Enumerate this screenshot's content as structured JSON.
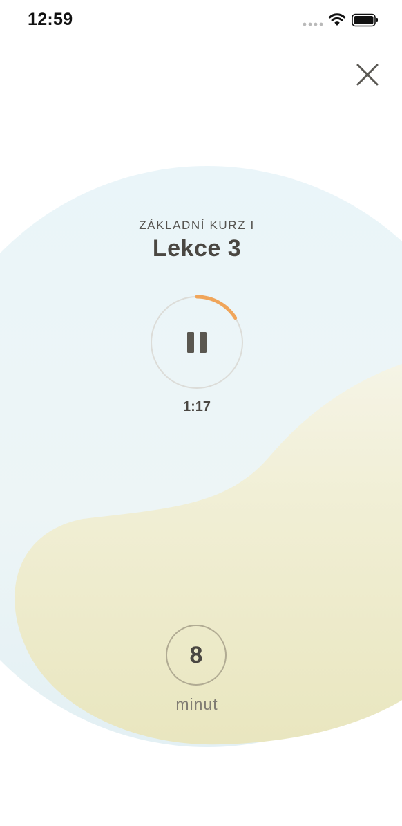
{
  "status_bar": {
    "time": "12:59",
    "icons": [
      "cellular-signal-icon",
      "wifi-icon",
      "battery-icon"
    ]
  },
  "close": {
    "icon": "close-icon"
  },
  "lesson": {
    "course": "ZÁKLADNÍ KURZ I",
    "title": "Lekce 3"
  },
  "player": {
    "state_icon": "pause-icon",
    "elapsed": "1:17",
    "progress": 0.16
  },
  "duration": {
    "value": "8",
    "unit": "minut"
  },
  "colors": {
    "progress_arc": "#f0a55a",
    "ring": "#dcdcd8",
    "text_dark": "#4a4742",
    "blob_blue": "#e9f4f8",
    "blob_yellow": "#eeebc7"
  }
}
